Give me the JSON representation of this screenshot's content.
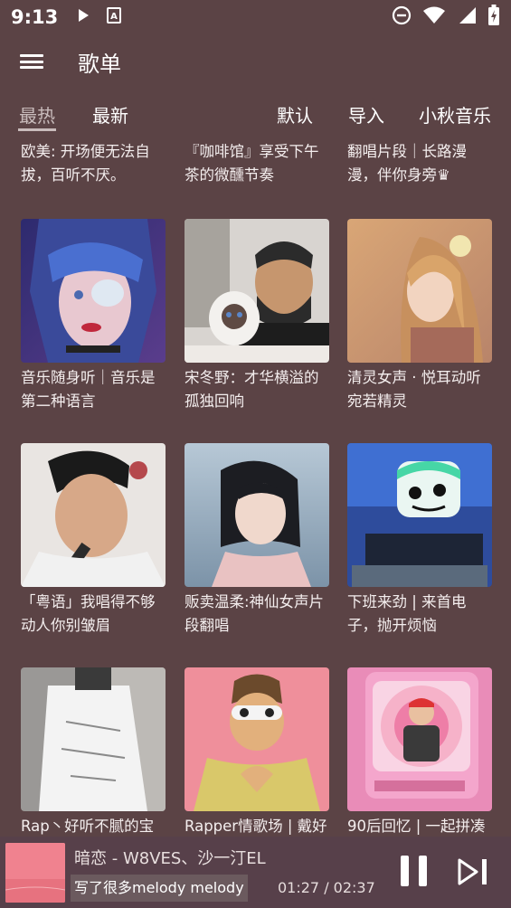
{
  "status_bar": {
    "time": "9:13",
    "icons": [
      "play-icon",
      "app-a-icon",
      "do-not-disturb-icon",
      "wifi-icon",
      "signal-icon",
      "battery-icon"
    ]
  },
  "app_bar": {
    "title": "歌单",
    "menu_icon": "hamburger-menu-icon"
  },
  "tabs": {
    "items": [
      {
        "label": "最热",
        "active": true
      },
      {
        "label": "最新",
        "active": false
      },
      {
        "label": "默认",
        "active": false
      },
      {
        "label": "导入",
        "active": false
      },
      {
        "label": "小秋音乐",
        "active": false
      }
    ]
  },
  "playlists": [
    {
      "title": "欧美: 开场便无法自拔，百听不厌。"
    },
    {
      "title": "『咖啡馆』享受下午茶的微醺节奏"
    },
    {
      "title": "翻唱片段｜长路漫漫，伴你身旁♛"
    },
    {
      "title": "音乐随身听｜音乐是第二种语言"
    },
    {
      "title": "宋冬野：才华横溢的孤独回响"
    },
    {
      "title": "清灵女声 · 悦耳动听宛若精灵"
    },
    {
      "title": "「粤语」我唱得不够动人你别皱眉"
    },
    {
      "title": "贩卖温柔:神仙女声片段翻唱"
    },
    {
      "title": "下班来劲 | 来首电子，抛开烦恼"
    },
    {
      "title": "Rap丶好听不腻的宝"
    },
    {
      "title": "Rapper情歌场 | 戴好"
    },
    {
      "title": "90后回忆 | 一起拼凑"
    }
  ],
  "player": {
    "song": "暗恋 - W8VES、沙一汀EL",
    "lyric": "写了很多melody melody",
    "time": "01:27 / 02:37",
    "pause_icon": "pause-icon",
    "next_icon": "skip-next-icon"
  },
  "colors": {
    "background": "#5b4345",
    "player_background": "#57404a",
    "active_tab": "#c9bcbc"
  }
}
